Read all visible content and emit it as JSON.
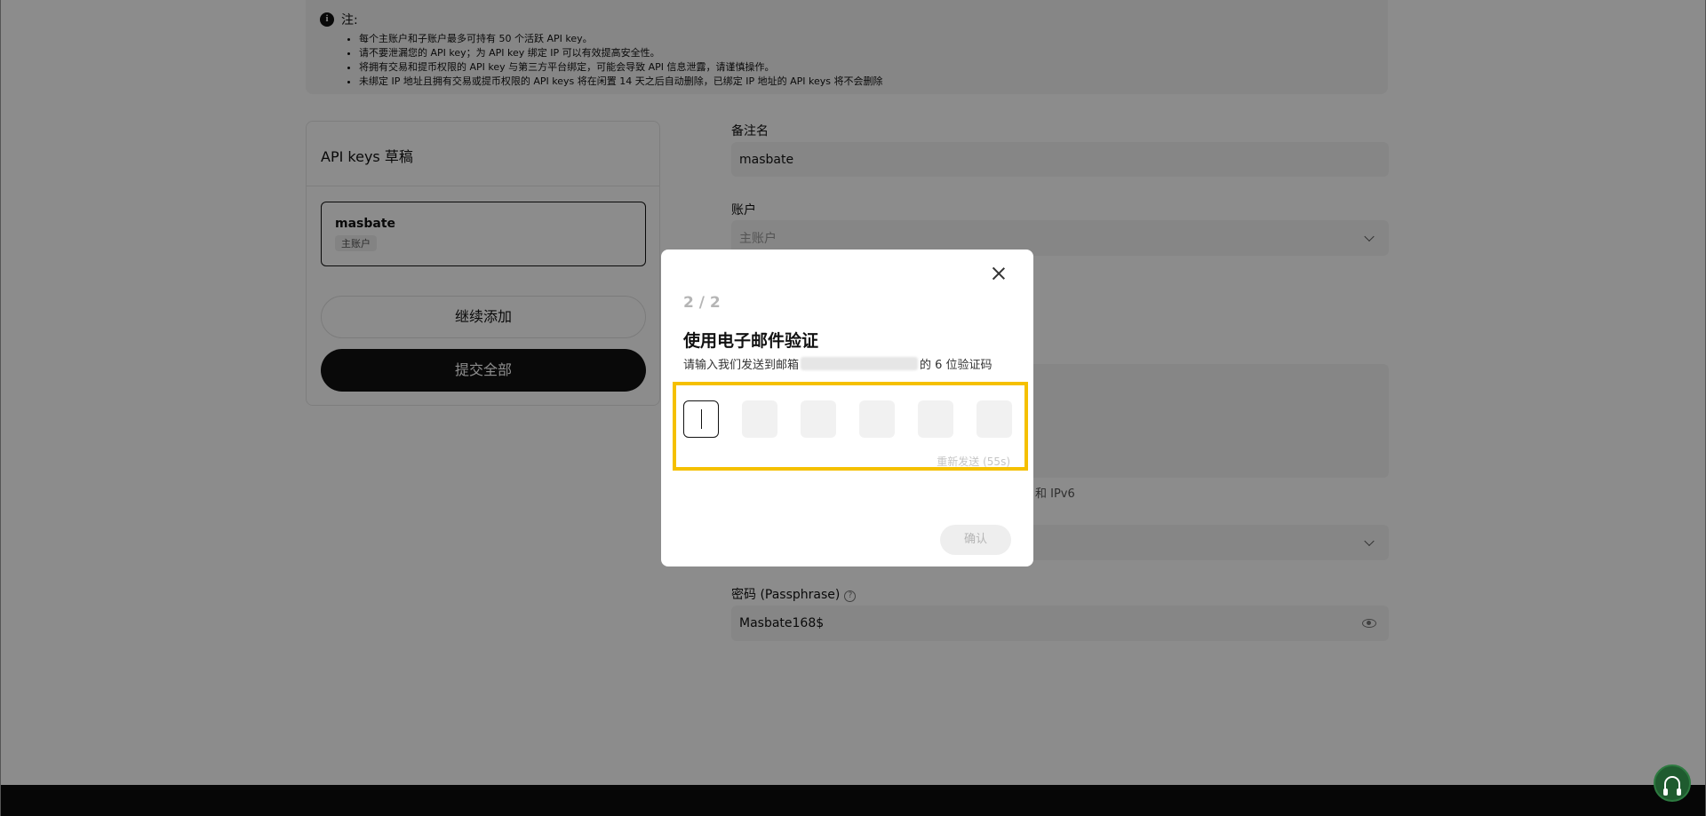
{
  "notes": {
    "title": "注:",
    "items": [
      "每个主账户和子账户最多可持有 50 个活跃 API key。",
      "请不要泄漏您的 API key；为 API key 绑定 IP 可以有效提高安全性。",
      "将拥有交易和提币权限的 API key 与第三方平台绑定，可能会导致 API 信息泄露，请谨慎操作。",
      "未绑定 IP 地址且拥有交易或提币权限的 API keys 将在闲置 14 天之后自动删除，已绑定 IP 地址的 API keys 将不会删除"
    ]
  },
  "drafts": {
    "title": "API keys 草稿",
    "item": {
      "name": "masbate",
      "tag": "主账户"
    },
    "continue_label": "继续添加",
    "submit_label": "提交全部"
  },
  "form": {
    "remark_label": "备注名",
    "remark_value": "masbate",
    "account_label": "账户",
    "account_value": "主账户",
    "ip_hint_tail": "和 IPv6",
    "password_label": "密码 (Passphrase)",
    "password_value": "Masbate168$"
  },
  "modal": {
    "step": "2 / 2",
    "title": "使用电子邮件验证",
    "subtitle_prefix": "请输入我们发送到邮箱",
    "subtitle_suffix": "的 6 位验证码",
    "resend": "重新发送 (55s)",
    "confirm": "确认"
  },
  "colors": {
    "accent_highlight": "#f5c000",
    "primary_button": "#121212",
    "support_button": "#1f5b2f"
  }
}
